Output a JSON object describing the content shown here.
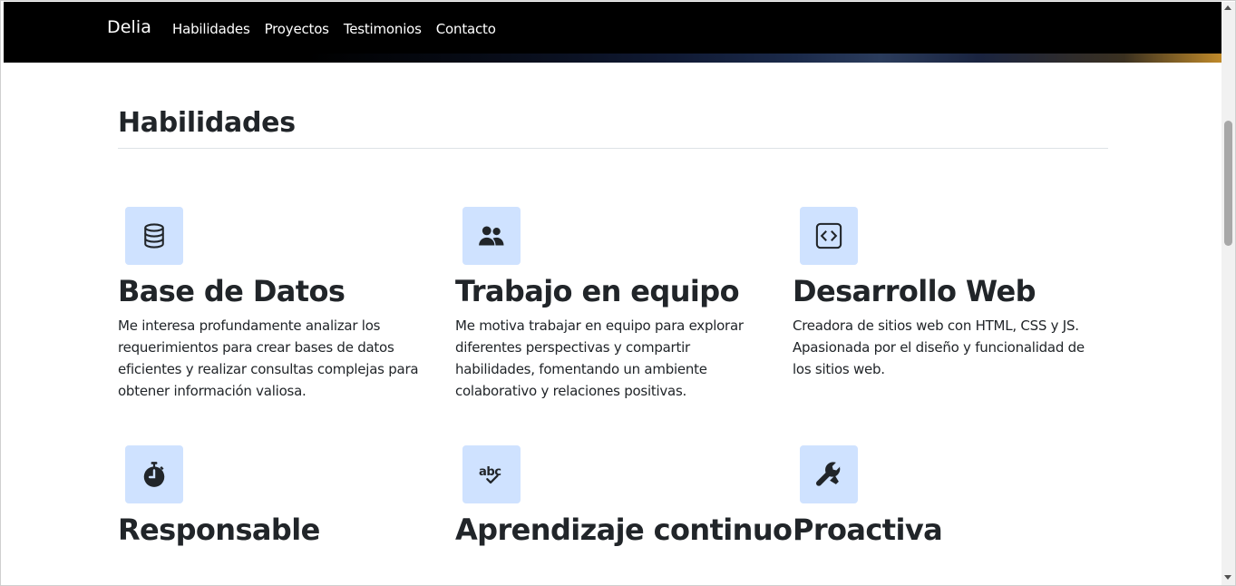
{
  "navbar": {
    "brand": "Delia",
    "links": [
      "Habilidades",
      "Proyectos",
      "Testimonios",
      "Contacto"
    ]
  },
  "section": {
    "title": "Habilidades"
  },
  "skills": [
    {
      "icon": "database-icon",
      "title": "Base de Datos",
      "text": "Me interesa profundamente analizar los requerimientos para crear bases de datos eficientes y realizar consultas complejas para obtener información valiosa."
    },
    {
      "icon": "people-icon",
      "title": "Trabajo en equipo",
      "text": "Me motiva trabajar en equipo para explorar diferentes perspectivas y compartir habilidades, fomentando un ambiente colaborativo y relaciones positivas."
    },
    {
      "icon": "code-icon",
      "title": "Desarrollo Web",
      "text": "Creadora de sitios web con HTML, CSS y JS. Apasionada por el diseño y funcionalidad de los sitios web."
    },
    {
      "icon": "stopwatch-icon",
      "title": "Responsable",
      "text": ""
    },
    {
      "icon": "spellcheck-icon",
      "title": "Aprendizaje continuo",
      "text": ""
    },
    {
      "icon": "wrench-icon",
      "title": "Proactiva",
      "text": ""
    }
  ],
  "colors": {
    "navbar_bg": "#000000",
    "icon_bg": "#cfe2ff",
    "text": "#212529"
  }
}
